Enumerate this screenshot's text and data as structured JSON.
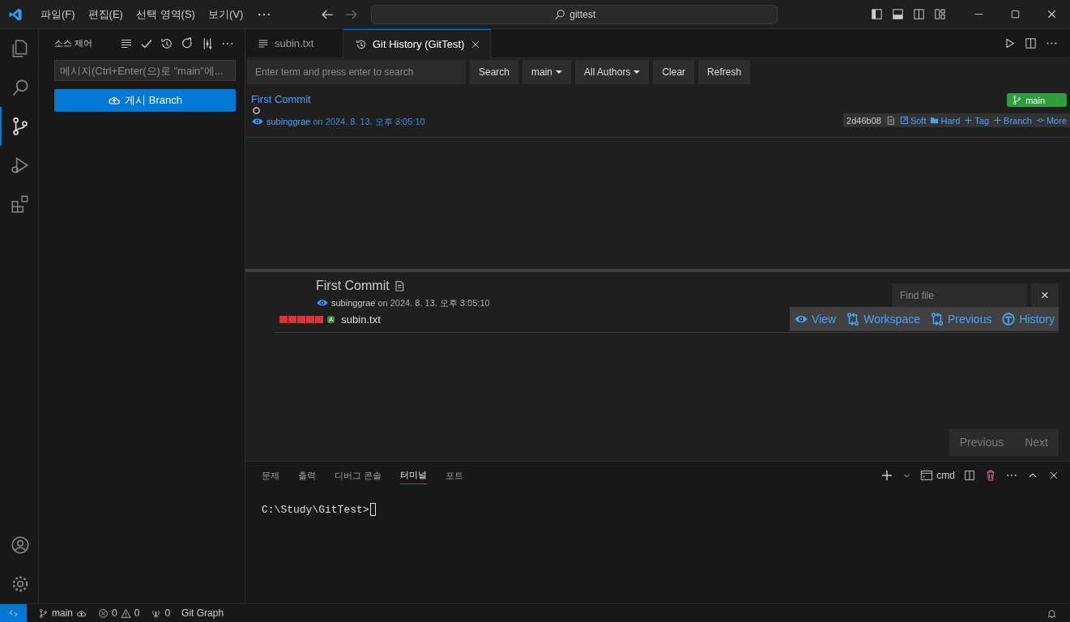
{
  "title_bar": {
    "menu": [
      {
        "label": "파일(F)"
      },
      {
        "label": "편집(E)"
      },
      {
        "label": "선택 영역(S)"
      },
      {
        "label": "보기(V)"
      }
    ],
    "search": "gittest"
  },
  "source_control": {
    "title": "소스 제어",
    "message_placeholder": "메시지(Ctrl+Enter(으)로 \"main\"에...",
    "publish_button": "게시 Branch"
  },
  "editor_tabs": [
    {
      "label": "subin.txt",
      "selected": false,
      "kind": "file"
    },
    {
      "label": "Git History (GitTest)",
      "selected": true,
      "kind": "history"
    }
  ],
  "toolbar": {
    "search_placeholder": "Enter term and press enter to search",
    "buttons": [
      {
        "label": "Search",
        "kind": "button"
      },
      {
        "label": "main",
        "kind": "dropdown"
      },
      {
        "label": "All Authors",
        "kind": "dropdown"
      },
      {
        "label": "Clear",
        "kind": "button"
      },
      {
        "label": "Refresh",
        "kind": "button"
      }
    ]
  },
  "commits": [
    {
      "title": "First Commit",
      "author": "subinggrae",
      "date": "on 2024. 8. 13. 오후 3:05:10",
      "hash": "2d46b08",
      "branch": "main",
      "actions": [
        {
          "label": "Soft",
          "kind": "soft"
        },
        {
          "label": "Hard",
          "kind": "hard"
        },
        {
          "label": "Tag",
          "kind": "plus"
        },
        {
          "label": "Branch",
          "kind": "plus"
        },
        {
          "label": "More",
          "kind": "more"
        }
      ]
    }
  ],
  "details": {
    "title": "First Commit",
    "author": "subinggrae",
    "date": "on 2024. 8. 13. 오후 3:05:10",
    "find_placeholder": "Find file",
    "close": "×",
    "files": [
      {
        "name": "subin.txt",
        "status": "A"
      }
    ],
    "file_actions": [
      {
        "label": "View",
        "kind": "view"
      },
      {
        "label": "Workspace",
        "kind": "compare"
      },
      {
        "label": "Previous",
        "kind": "compare"
      },
      {
        "label": "History",
        "kind": "history"
      }
    ],
    "pager": [
      "Previous",
      "Next"
    ]
  },
  "panel": {
    "tabs": [
      {
        "label": "문제",
        "selected": false
      },
      {
        "label": "출력",
        "selected": false
      },
      {
        "label": "디버그 콘솔",
        "selected": false
      },
      {
        "label": "터미널",
        "selected": true
      },
      {
        "label": "포트",
        "selected": false
      }
    ],
    "shell": "cmd",
    "terminal_line": "C:\\Study\\GitTest>"
  },
  "status_bar": {
    "branch": "main",
    "errors": "0",
    "warnings": "0",
    "ports": "0",
    "extension": "Git Graph"
  }
}
